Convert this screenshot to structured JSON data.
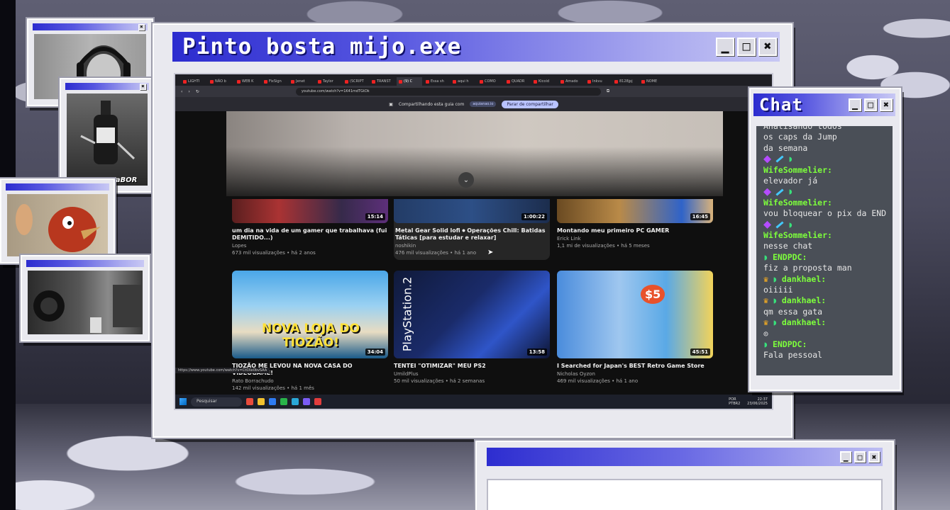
{
  "main_window": {
    "title": "Pinto bosta mijo.exe"
  },
  "controls": {
    "minimize": "▁",
    "maximize": "□",
    "close": "✖"
  },
  "browser": {
    "tabs": [
      "LIGHTI",
      "NÃO b",
      "WEB K",
      "FixSign",
      "Jenet",
      "Taylor",
      "(SCRIPT",
      "TRANST",
      "(9) C",
      "Essa sh",
      "aqui h",
      "COMO",
      "QUADR",
      "Kicoid",
      "Amado",
      "Inkvu",
      "8128jpj",
      "NOME"
    ],
    "active_tab_index": 8,
    "url": "youtube.com/watch?v=1K41mdTGtDk",
    "share_text": "Compartilhando esta guia com",
    "share_chip": "aquianao.io",
    "share_button": "Parar de compartilhar",
    "status_url": "https://www.youtube.com/watch?v=Ct0Xe0bvSAA"
  },
  "videos_top": [
    {
      "title": "um dia na vida de um gamer que trabalhava (fui DEMITIDO...)",
      "channel": "Lopes",
      "meta": "673 mil visualizações • há 2 anos",
      "duration": "15:14"
    },
    {
      "title": "Metal Gear Solid lofi ⏺ Operações Chill: Batidas Táticas [para estudar e relaxar]",
      "channel": "noshikin",
      "meta": "476 mil visualizações • há 1 ano",
      "duration": "1:00:22"
    },
    {
      "title": "Montando meu primeiro PC GAMER",
      "channel": "Erick Link",
      "meta": "1,1 mi de visualizações • há 5 meses",
      "duration": "16:45"
    }
  ],
  "videos_bottom": [
    {
      "title": "TIOZÃO ME LEVOU NA NOVA CASA DO VIDEOGAME!",
      "channel": "Rato Borrachudo",
      "meta": "142 mil visualizações • há 1 mês",
      "duration": "34:04",
      "thumb_text": "NOVA LOJA DO TIOZÃO!"
    },
    {
      "title": "TENTEI \"OTIMIZAR\" MEU PS2",
      "channel": "UmildPlus",
      "meta": "50 mil visualizações • há 2 semanas",
      "duration": "13:58",
      "thumb_text": "PlayStation.2"
    },
    {
      "title": "I Searched for Japan's BEST Retro Game Store",
      "channel": "Nicholas Oyzon",
      "meta": "469 mil visualizações • há 1 ano",
      "duration": "45:51",
      "thumb_text": "$5"
    }
  ],
  "taskbar": {
    "search_placeholder": "Pesquisar",
    "lang": "POR PTBR2",
    "time": "22:37",
    "date": "23/06/2025"
  },
  "webcam": {
    "caption": "Tung Tung saBOR"
  },
  "chat": {
    "title": "Chat",
    "messages": [
      {
        "badges": [],
        "user": "",
        "text": "Analisando todos"
      },
      {
        "badges": [],
        "user": "",
        "text": "os caps da Jump"
      },
      {
        "badges": [],
        "user": "",
        "text": "da semana"
      },
      {
        "badges": [
          "purple",
          "sword",
          "green"
        ],
        "user": "WifeSommelier:",
        "text": "elevador já"
      },
      {
        "badges": [
          "purple",
          "sword",
          "green"
        ],
        "user": "WifeSommelier:",
        "text": "vou bloquear o pix da END"
      },
      {
        "badges": [
          "purple",
          "sword",
          "green"
        ],
        "user": "WifeSommelier:",
        "text": "nesse chat"
      },
      {
        "badges": [
          "green"
        ],
        "user": "ENDPDC:",
        "text": "fiz a proposta man"
      },
      {
        "badges": [
          "crown",
          "green"
        ],
        "user": "dankhael:",
        "text": "oiiiii"
      },
      {
        "badges": [
          "crown",
          "green"
        ],
        "user": "dankhael:",
        "text": "qm essa gata"
      },
      {
        "badges": [
          "crown",
          "green"
        ],
        "user": "dankhael:",
        "text": "⊙"
      },
      {
        "badges": [
          "green"
        ],
        "user": "ENDPDC:",
        "text": "Fala pessoal"
      }
    ]
  }
}
